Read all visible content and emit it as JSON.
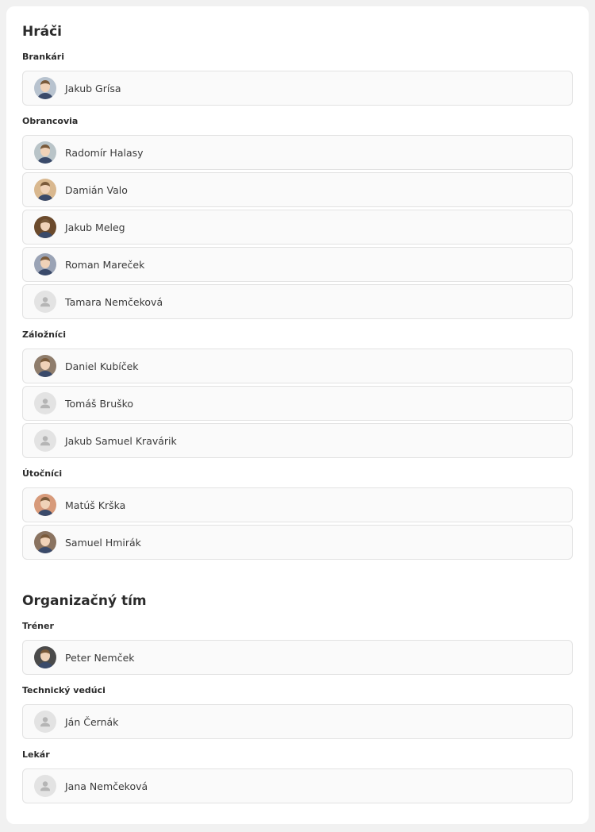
{
  "sections": [
    {
      "title": "Hráči",
      "groups": [
        {
          "label": "Brankári",
          "people": [
            {
              "name": "Jakub Grísa",
              "avatar": "photo",
              "tone": "#b8c3cf"
            }
          ]
        },
        {
          "label": "Obrancovia",
          "people": [
            {
              "name": "Radomír Halasy",
              "avatar": "photo",
              "tone": "#b9c4c8"
            },
            {
              "name": "Damián Valo",
              "avatar": "photo",
              "tone": "#d9b88f"
            },
            {
              "name": "Jakub Meleg",
              "avatar": "photo",
              "tone": "#6b4a2c"
            },
            {
              "name": "Roman Mareček",
              "avatar": "photo",
              "tone": "#9aa3b5"
            },
            {
              "name": "Tamara Nemčeková",
              "avatar": "placeholder",
              "tone": "#e3e3e3"
            }
          ]
        },
        {
          "label": "Záložníci",
          "people": [
            {
              "name": "Daniel Kubíček",
              "avatar": "photo",
              "tone": "#8f7d6c"
            },
            {
              "name": "Tomáš Bruško",
              "avatar": "placeholder",
              "tone": "#e3e3e3"
            },
            {
              "name": "Jakub Samuel Kravárik",
              "avatar": "placeholder",
              "tone": "#e3e3e3"
            }
          ]
        },
        {
          "label": "Útočníci",
          "people": [
            {
              "name": "Matúš Krška",
              "avatar": "photo",
              "tone": "#d79a7a"
            },
            {
              "name": "Samuel Hmirák",
              "avatar": "photo",
              "tone": "#8a7360"
            }
          ]
        }
      ]
    },
    {
      "title": "Organizačný tím",
      "groups": [
        {
          "label": "Tréner",
          "people": [
            {
              "name": "Peter Nemček",
              "avatar": "photo",
              "tone": "#4a4a4a"
            }
          ]
        },
        {
          "label": "Technický vedúci",
          "people": [
            {
              "name": "Ján Černák",
              "avatar": "placeholder",
              "tone": "#e3e3e3"
            }
          ]
        },
        {
          "label": "Lekár",
          "people": [
            {
              "name": "Jana Nemčeková",
              "avatar": "placeholder",
              "tone": "#e3e3e3"
            }
          ]
        }
      ]
    }
  ],
  "icons": {
    "placeholder": "person-icon",
    "photo": "profile-photo"
  }
}
